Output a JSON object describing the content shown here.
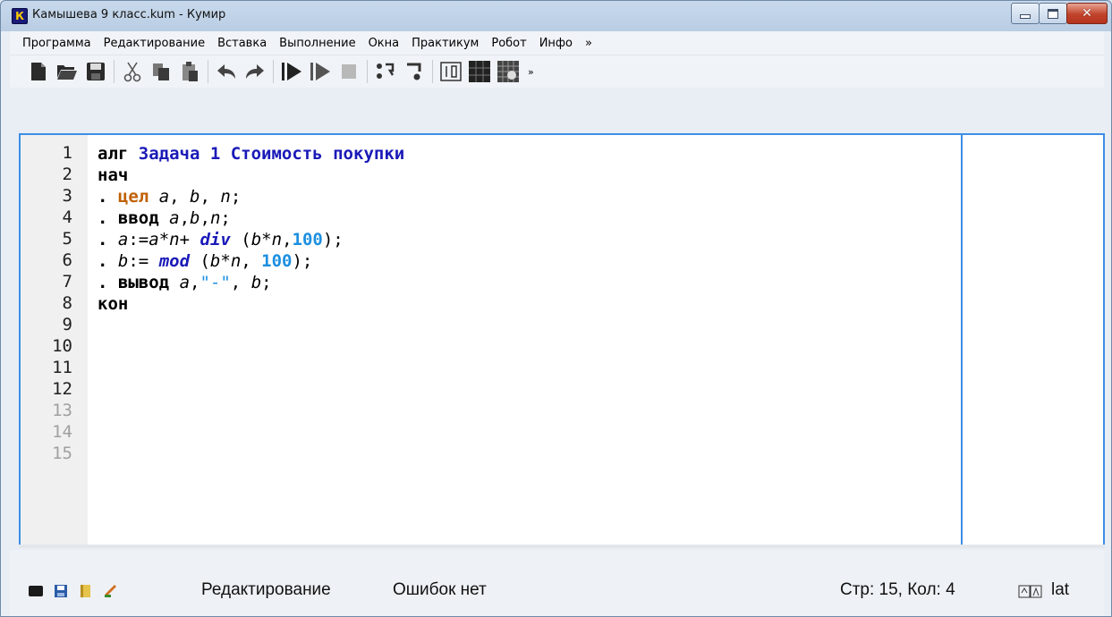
{
  "window": {
    "title": "Камышева 9 класс.kum - Кумир",
    "app_icon_letter": "К"
  },
  "menubar": {
    "items": [
      "Программа",
      "Редактирование",
      "Вставка",
      "Выполнение",
      "Окна",
      "Практикум",
      "Робот",
      "Инфо",
      "»"
    ]
  },
  "toolbar": {
    "overflow": "»"
  },
  "editor": {
    "line_numbers": [
      "1",
      "2",
      "3",
      "4",
      "5",
      "6",
      "7",
      "8",
      "9",
      "10",
      "11",
      "12",
      "13",
      "14",
      "15"
    ]
  },
  "status": {
    "mode": "Редактирование",
    "errors": "Ошибок нет",
    "position": "Стр: 15, Кол: 4",
    "keyboard_layout": "lat"
  },
  "colors": {
    "editor_border": "#3d8ee6",
    "keyword_blue": "#1a1ab8",
    "type_orange": "#c06000",
    "number_blue": "#1c8fe0"
  }
}
